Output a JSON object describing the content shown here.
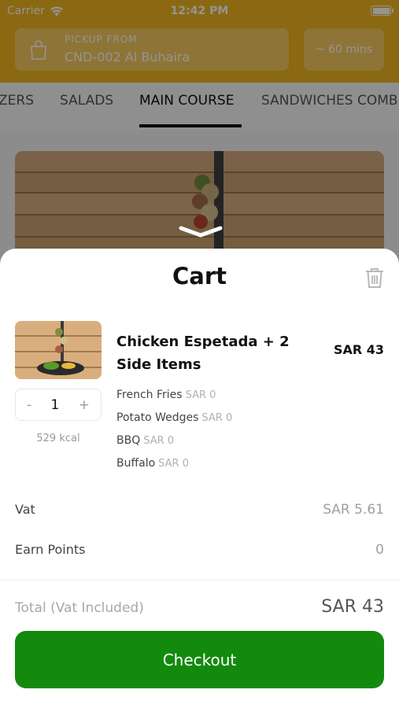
{
  "status_bar": {
    "carrier": "Carrier",
    "time": "12:42 PM"
  },
  "header": {
    "pickup_label": "PICKUP FROM",
    "pickup_value": "CND-002 Al Buhaira",
    "time_estimate": "~ 60 mins",
    "brand_color": "#f0b51f"
  },
  "tabs": [
    {
      "label": "ZERS",
      "active": false
    },
    {
      "label": "SALADS",
      "active": false
    },
    {
      "label": "MAIN COURSE",
      "active": true
    },
    {
      "label": "SANDWICHES COMB",
      "active": false
    }
  ],
  "cart": {
    "title": "Cart",
    "item": {
      "name": "Chicken Espetada + 2 Side Items",
      "price": "SAR 43",
      "quantity": "1",
      "minus": "-",
      "plus": "+",
      "kcal": "529 kcal",
      "modifiers": [
        {
          "name": "French Fries",
          "price": "SAR 0"
        },
        {
          "name": "Potato Wedges",
          "price": "SAR 0"
        },
        {
          "name": "BBQ",
          "price": "SAR 0"
        },
        {
          "name": "Buffalo",
          "price": "SAR 0"
        }
      ]
    },
    "vat_label": "Vat",
    "vat_value": "SAR 5.61",
    "points_label": "Earn Points",
    "points_value": "0",
    "total_label": "Total",
    "total_note": "(Vat Included)",
    "total_value": "SAR 43",
    "checkout_label": "Checkout",
    "checkout_color": "#138a0e"
  },
  "icons": [
    "wifi-icon",
    "battery-icon",
    "shopping-bag-icon",
    "chevron-down-icon",
    "trash-icon"
  ]
}
